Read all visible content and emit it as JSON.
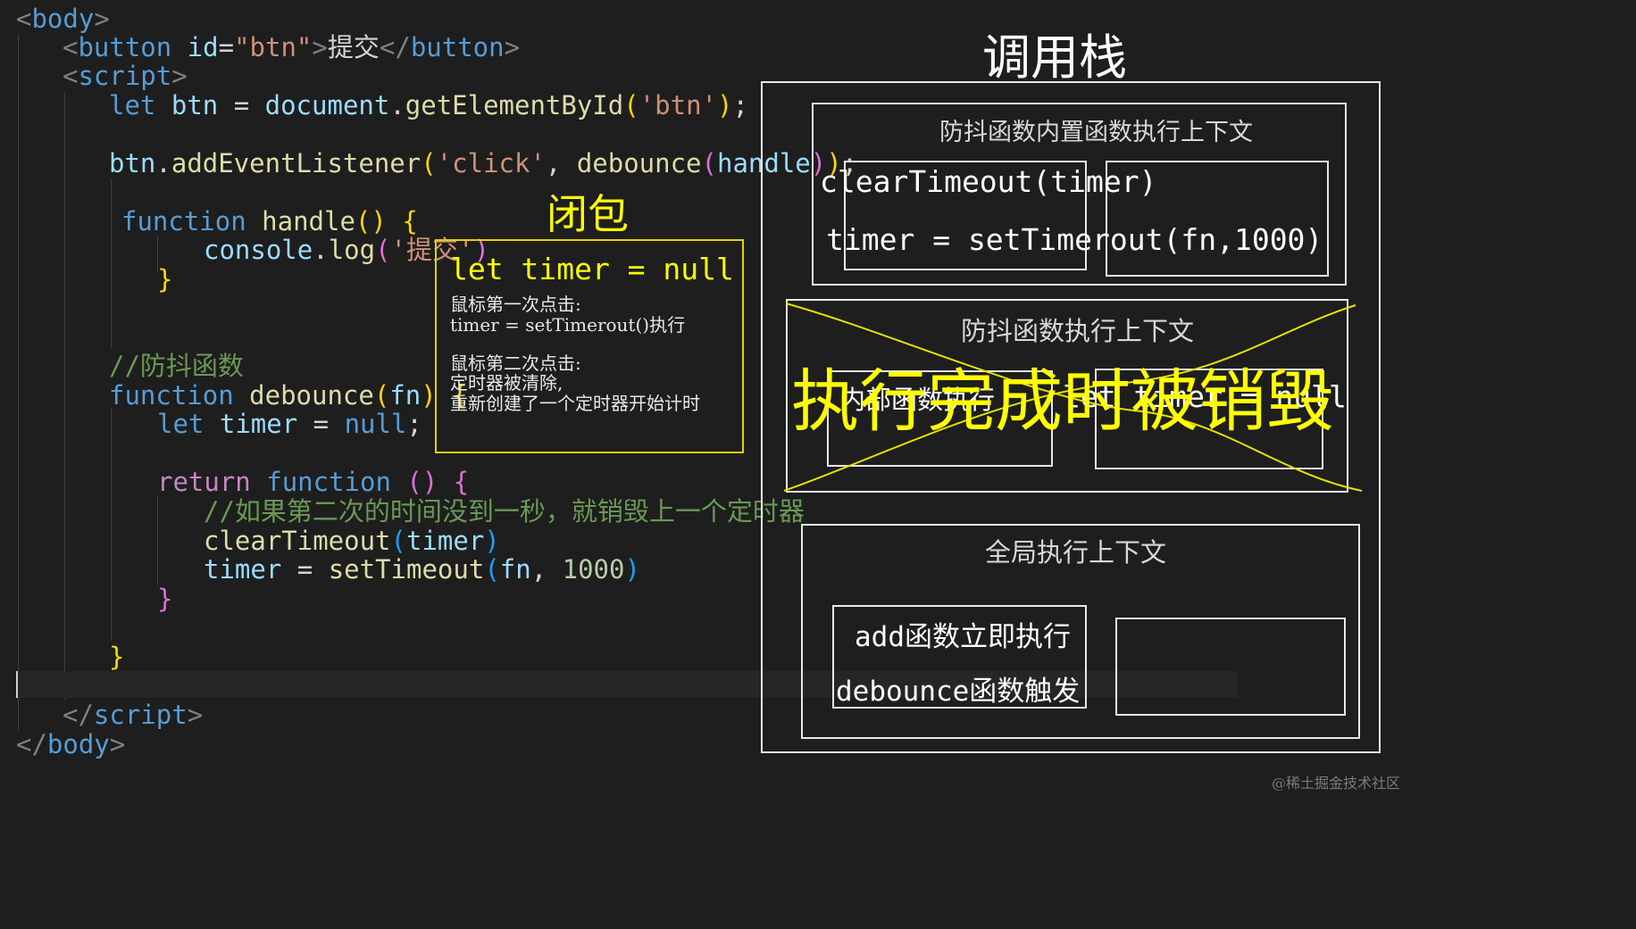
{
  "code": {
    "body_open": "body",
    "button_tag": "button",
    "button_attr": "id",
    "button_id": "\"btn\"",
    "button_text": "提交",
    "script_tag": "script",
    "line_let": "let",
    "line_btn": "btn",
    "line_eq": " = ",
    "line_document": "document",
    "line_getel": "getElementById",
    "line_btnstr": "'btn'",
    "line_listener_obj": "btn",
    "line_listener_fn": "addEventListener",
    "line_click": "'click'",
    "line_debounce": "debounce",
    "line_handle": "handle",
    "function_kw": "function",
    "handle_name": "handle",
    "console": "console",
    "log": "log",
    "log_str": "'提交'",
    "comment_debounce": "//防抖函数",
    "debounce_name": "debounce",
    "param_fn": "fn",
    "let_kw": "let",
    "timer": "timer",
    "null": "null",
    "return_kw": "return",
    "comment_inner": "//如果第二次的时间没到一秒，就销毁上一个定时器",
    "clear_fn": "clearTimeout",
    "set_fn": "setTimeout",
    "delay": "1000",
    "script_close": "script",
    "body_close": "body"
  },
  "closure": {
    "title": "闭包",
    "decl": "let timer = null",
    "click1_label": "鼠标第一次点击:",
    "click1_action": "timer = setTimerout()执行",
    "click2_label": "鼠标第二次点击:",
    "click2_line1": "定时器被清除,",
    "click2_line2": "重新创建了一个定时器开始计时"
  },
  "stack": {
    "title": "调用栈",
    "inner_ctx_label": "防抖函数内置函数执行上下文",
    "inner_line1": "clearTimeout(timer)",
    "inner_line2": "timer = setTimerout(fn,1000)",
    "debounce_ctx_label": "防抖函数执行上下文",
    "debounce_inner_left": "内部函数执行",
    "debounce_inner_right": "let timer = null",
    "destroyed_note": "执行完成时被销毁",
    "global_ctx_label": "全局执行上下文",
    "global_line1": "add函数立即执行",
    "global_line2": "debounce函数触发"
  },
  "watermark": "@稀土掘金技术社区",
  "colors": {
    "background": "#1e1e1e",
    "annotation_yellow": "#ffff00",
    "box_border": "#e8e8e8"
  }
}
